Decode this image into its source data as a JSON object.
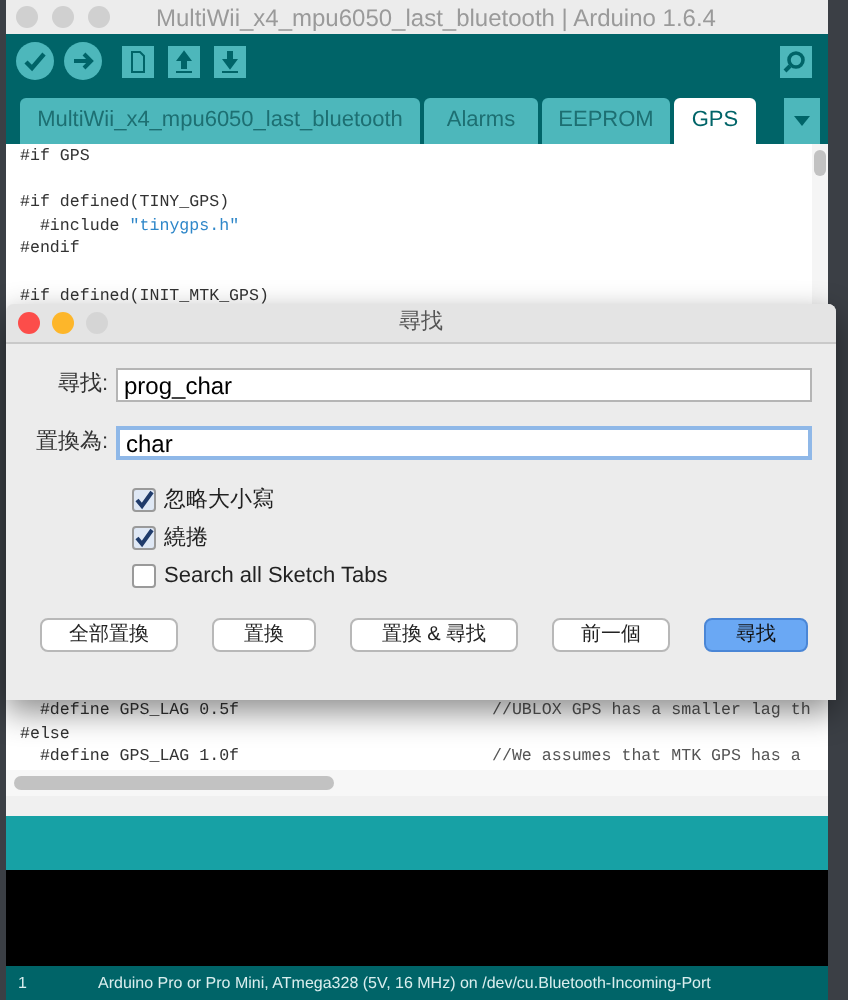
{
  "window": {
    "title": "MultiWii_x4_mpu6050_last_bluetooth | Arduino 1.6.4"
  },
  "tabs": [
    {
      "label": "MultiWii_x4_mpu6050_last_bluetooth",
      "selected": false
    },
    {
      "label": "Alarms",
      "selected": false
    },
    {
      "label": "EEPROM",
      "selected": false
    },
    {
      "label": "GPS",
      "selected": true
    }
  ],
  "code_top": [
    {
      "code": "#if GPS",
      "gap_before": false
    },
    {
      "code": "#if defined(TINY_GPS)",
      "gap_before": true
    },
    {
      "code": "  #include ",
      "string": "\"tinygps.h\"",
      "gap_before": false
    },
    {
      "code": "#endif",
      "gap_before": false
    },
    {
      "code": "#if defined(INIT_MTK_GPS)",
      "gap_before": true
    }
  ],
  "code_bottom": [
    {
      "code": "  #define GPS_LAG 0.5f",
      "comment": "//UBLOX GPS has a smaller lag th"
    },
    {
      "code": "#else"
    },
    {
      "code": "  #define GPS_LAG 1.0f",
      "comment": "//We assumes that MTK GPS has a"
    }
  ],
  "dialog": {
    "title": "尋找",
    "fields": [
      {
        "label": "尋找:",
        "value": "prog_char",
        "focused": false
      },
      {
        "label": "置換為:",
        "value": "char",
        "focused": true
      }
    ],
    "options": [
      {
        "label": "忽略大小寫",
        "checked": true
      },
      {
        "label": "繞捲",
        "checked": true
      },
      {
        "label": "Search all Sketch Tabs",
        "checked": false
      }
    ],
    "buttons": [
      {
        "label": "全部置換",
        "default": false
      },
      {
        "label": "置換",
        "default": false
      },
      {
        "label": "置換 & 尋找",
        "default": false
      },
      {
        "label": "前一個",
        "default": false
      },
      {
        "label": "尋找",
        "default": true
      }
    ]
  },
  "status_bar": {
    "line": "1",
    "board": "Arduino Pro or Pro Mini, ATmega328 (5V, 16 MHz) on /dev/cu.Bluetooth-Incoming-Port"
  }
}
